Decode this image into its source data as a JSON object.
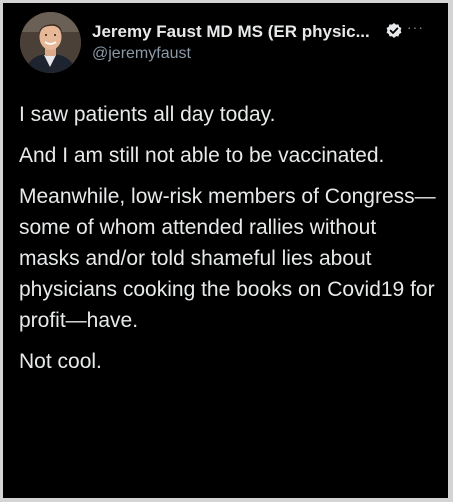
{
  "author": {
    "display_name": "Jeremy Faust MD MS (ER physic...",
    "handle": "@jeremyfaust",
    "verified": true
  },
  "icons": {
    "verified": "verified-badge-icon",
    "more": "more-options-icon"
  },
  "colors": {
    "background": "#000000",
    "text": "#e7e9ea",
    "secondary_text": "#8b98a5",
    "border": "#d4d4d4"
  },
  "tweet": {
    "paragraphs": [
      "I saw patients all day today.",
      "And I am still not able to be vaccinated.",
      "Meanwhile, low-risk members of Congress—some of whom attended rallies without masks and/or told shameful lies about physicians cooking the books on Covid19 for profit—have.",
      "Not cool."
    ]
  }
}
